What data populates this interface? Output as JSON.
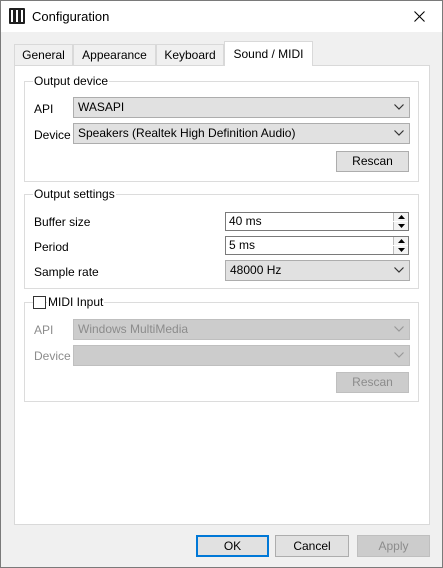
{
  "window": {
    "title": "Configuration"
  },
  "tabs": [
    {
      "label": "General"
    },
    {
      "label": "Appearance"
    },
    {
      "label": "Keyboard"
    },
    {
      "label": "Sound / MIDI"
    }
  ],
  "output_device": {
    "title": "Output device",
    "api_label": "API",
    "api_value": "WASAPI",
    "device_label": "Device",
    "device_value": "Speakers (Realtek High Definition Audio)",
    "rescan_label": "Rescan"
  },
  "output_settings": {
    "title": "Output settings",
    "buffer_label": "Buffer size",
    "buffer_value": "40 ms",
    "period_label": "Period",
    "period_value": "5 ms",
    "rate_label": "Sample rate",
    "rate_value": "48000 Hz"
  },
  "midi_input": {
    "title": "MIDI Input",
    "checked": false,
    "api_label": "API",
    "api_value": "Windows MultiMedia",
    "device_label": "Device",
    "device_value": "",
    "rescan_label": "Rescan"
  },
  "footer": {
    "ok_label": "OK",
    "cancel_label": "Cancel",
    "apply_label": "Apply"
  }
}
